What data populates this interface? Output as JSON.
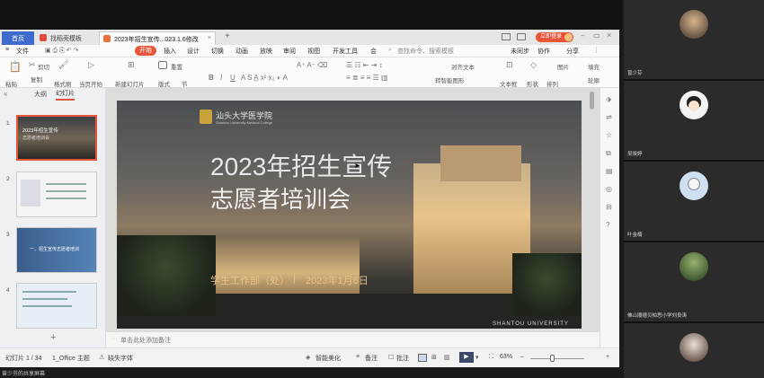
{
  "tabs": {
    "home": "首页",
    "template": "找稻壳模板",
    "document": "2023年招生宣传...023.1.6修改"
  },
  "titlebar": {
    "login": "立即登录"
  },
  "menu": {
    "file": "文件",
    "start": "开始",
    "insert": "插入",
    "design": "设计",
    "switch": "切换",
    "animation": "动画",
    "slideshow": "放映",
    "review": "审阅",
    "view": "视图",
    "devtools": "开发工具",
    "more": "会",
    "search_placeholder": "查找命令、搜索模板",
    "sync": "未同步",
    "collab": "协作",
    "share": "分享"
  },
  "ribbon": {
    "paste": "粘贴",
    "cut": "剪切",
    "copy": "复制",
    "format_painter": "格式刷",
    "play_from_current": "当页开始",
    "new_slide": "新建幻灯片",
    "layout": "版式",
    "section": "节",
    "reset": "重置",
    "textbox": "文本框",
    "shape": "形状",
    "arrange": "排列",
    "picture": "图片",
    "fill": "填充",
    "outline": "轮廓",
    "convert_smartart": "转智能图形",
    "align_text": "对齐文本"
  },
  "leftpanel": {
    "tab_outline": "大纲",
    "tab_slides": "幻灯片",
    "thumb_numbers": [
      "1",
      "2",
      "3",
      "4"
    ],
    "thumb1_title": "2023年招生宣传",
    "thumb1_sub": "志愿者培训会",
    "thumb3_text": "一、招生宣传志愿者培训"
  },
  "slide": {
    "logo_text": "汕头大学医学院",
    "logo_sub": "Shantou University Medical College",
    "title": "2023年招生宣传",
    "subtitle": "志愿者培训会",
    "footer_dept": "学生工作部（处）",
    "footer_sep": "|",
    "footer_date": "2023年1月6日",
    "watermark": "SHANTOU UNIVERSITY"
  },
  "notes": {
    "placeholder": "单击此处添加备注"
  },
  "status": {
    "slide_index": "幻灯片 1 / 34",
    "theme": "1_Office 主题",
    "missing_font": "缺失字体",
    "beautify": "智能美化",
    "notes": "备注",
    "comment": "批注",
    "zoom": "63%"
  },
  "meeting": {
    "share_label": "曾少芬的共享屏幕",
    "participants": [
      {
        "name": "曾少芬"
      },
      {
        "name": "吴晓婷"
      },
      {
        "name": "叶金楠"
      },
      {
        "name": "佛山顺德贝柏思小学刘良涛"
      },
      {
        "name": ""
      }
    ]
  },
  "colors": {
    "accent_orange": "#e8553b",
    "home_tab_blue": "#3f6ccc",
    "play_button": "#3b4a6b"
  }
}
